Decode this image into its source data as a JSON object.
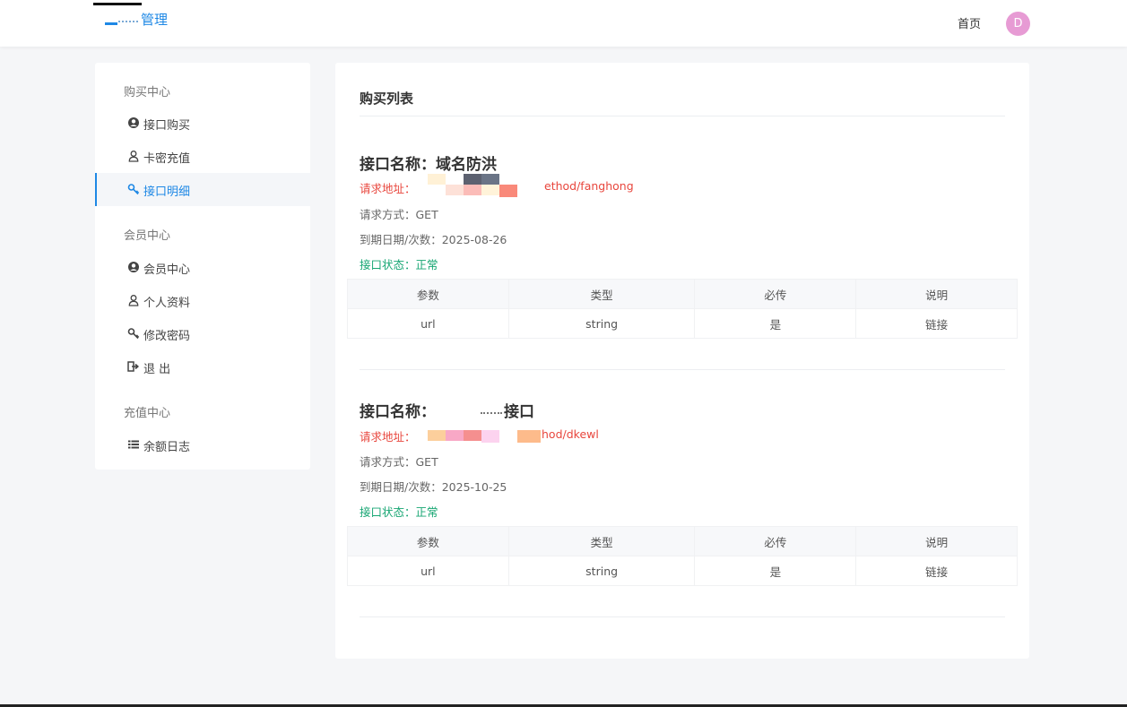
{
  "header": {
    "brand_title": "管理",
    "nav_home": "首页",
    "avatar_letter": "D",
    "accent_color": "#1e88e5"
  },
  "sidebar": {
    "groups": [
      {
        "title": "购买中心",
        "items": [
          {
            "label": "接口购买",
            "icon": "user-circle-icon"
          },
          {
            "label": "卡密充值",
            "icon": "user-outline-icon"
          },
          {
            "label": "接口明细",
            "icon": "key-icon",
            "active": true
          }
        ]
      },
      {
        "title": "会员中心",
        "items": [
          {
            "label": "会员中心",
            "icon": "user-circle-icon"
          },
          {
            "label": "个人资料",
            "icon": "user-outline-icon"
          },
          {
            "label": "修改密码",
            "icon": "key-icon"
          },
          {
            "label": "退 出",
            "icon": "sign-out-icon"
          }
        ]
      },
      {
        "title": "充值中心",
        "items": [
          {
            "label": "余额日志",
            "icon": "list-icon"
          }
        ]
      }
    ]
  },
  "main": {
    "title": "购买列表",
    "apis": [
      {
        "name": "接口名称：域名防洪",
        "url_label": "请求地址：",
        "url_visible": "ethod/fanghong",
        "method": "请求方式：GET",
        "expiry": "到期日期/次数：2025-08-26",
        "status": "接口状态：正常",
        "table": {
          "headers": [
            "参数",
            "类型",
            "必传",
            "说明"
          ],
          "rows": [
            [
              "url",
              "string",
              "是",
              "链接"
            ]
          ]
        }
      },
      {
        "name_prefix": "接口名称：",
        "name_suffix": "接口",
        "url_label": "请求地址：",
        "url_visible": "hod/dkewl",
        "method": "请求方式：GET",
        "expiry": "到期日期/次数：2025-10-25",
        "status": "接口状态：正常",
        "table": {
          "headers": [
            "参数",
            "类型",
            "必传",
            "说明"
          ],
          "rows": [
            [
              "url",
              "string",
              "是",
              "链接"
            ]
          ]
        }
      }
    ]
  }
}
